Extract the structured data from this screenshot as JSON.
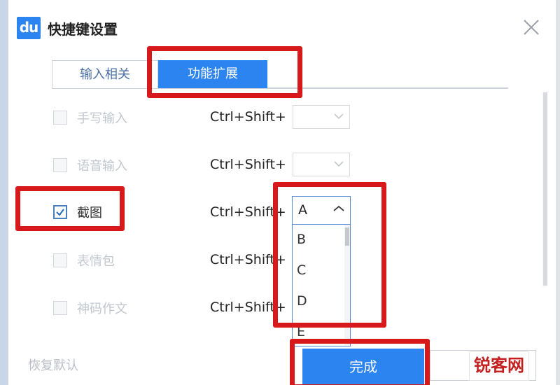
{
  "window": {
    "title": "快捷键设置",
    "logo_text": "du"
  },
  "tabs": [
    {
      "label": "输入相关",
      "active": false
    },
    {
      "label": "功能扩展",
      "active": true
    }
  ],
  "rows": [
    {
      "label": "手写输入",
      "checked": false,
      "enabled": false,
      "combo": "Ctrl+Shift+",
      "key": ""
    },
    {
      "label": "语音输入",
      "checked": false,
      "enabled": false,
      "combo": "Ctrl+Shift+",
      "key": ""
    },
    {
      "label": "截图",
      "checked": true,
      "enabled": true,
      "combo": "Ctrl+Shift+",
      "key": "A"
    },
    {
      "label": "表情包",
      "checked": false,
      "enabled": false,
      "combo": "Ctrl+Shift+",
      "key": ""
    },
    {
      "label": "神码作文",
      "checked": false,
      "enabled": false,
      "combo": "Ctrl+Shift+",
      "key": ""
    }
  ],
  "dropdown": {
    "selected": "A",
    "options": [
      "B",
      "C",
      "D",
      "E"
    ]
  },
  "footer": {
    "restore_label": "恢复默认",
    "done_label": "完成",
    "cancel_label": ""
  },
  "watermark": "锐客网",
  "colors": {
    "accent": "#2b84f0",
    "highlight": "#d7191c"
  },
  "icons": {
    "close": "close-icon",
    "checkbox": "checkbox-icon",
    "chevron": "chevron-down-icon"
  }
}
